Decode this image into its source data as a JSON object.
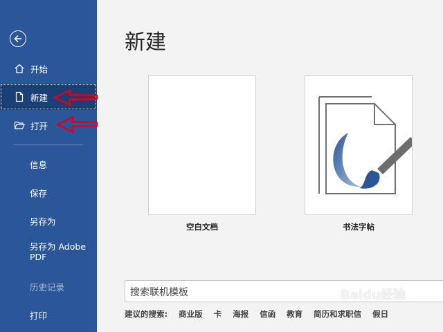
{
  "sidebar": {
    "items": [
      {
        "label": "开始",
        "icon": "home-icon"
      },
      {
        "label": "新建",
        "icon": "new-document-icon",
        "selected": true
      },
      {
        "label": "打开",
        "icon": "open-folder-icon"
      },
      {
        "label": "信息"
      },
      {
        "label": "保存"
      },
      {
        "label": "另存为"
      },
      {
        "label": "另存为 Adobe",
        "label2": "PDF"
      },
      {
        "label": "历史记录",
        "disabled": true
      },
      {
        "label": "打印"
      }
    ]
  },
  "main": {
    "title": "新建",
    "templates": [
      {
        "label": "空白文档"
      },
      {
        "label": "书法字帖"
      }
    ],
    "search": {
      "placeholder": "搜索联机模板"
    },
    "suggested": {
      "label": "建议的搜索:",
      "links": [
        "商业版",
        "卡",
        "海报",
        "信函",
        "教育",
        "简历和求职信",
        "假日"
      ]
    }
  },
  "watermark": "Baidu经验",
  "colors": {
    "sidebar": "#2b579a",
    "selected": "#1b3f77",
    "annotation": "#e0001a"
  }
}
